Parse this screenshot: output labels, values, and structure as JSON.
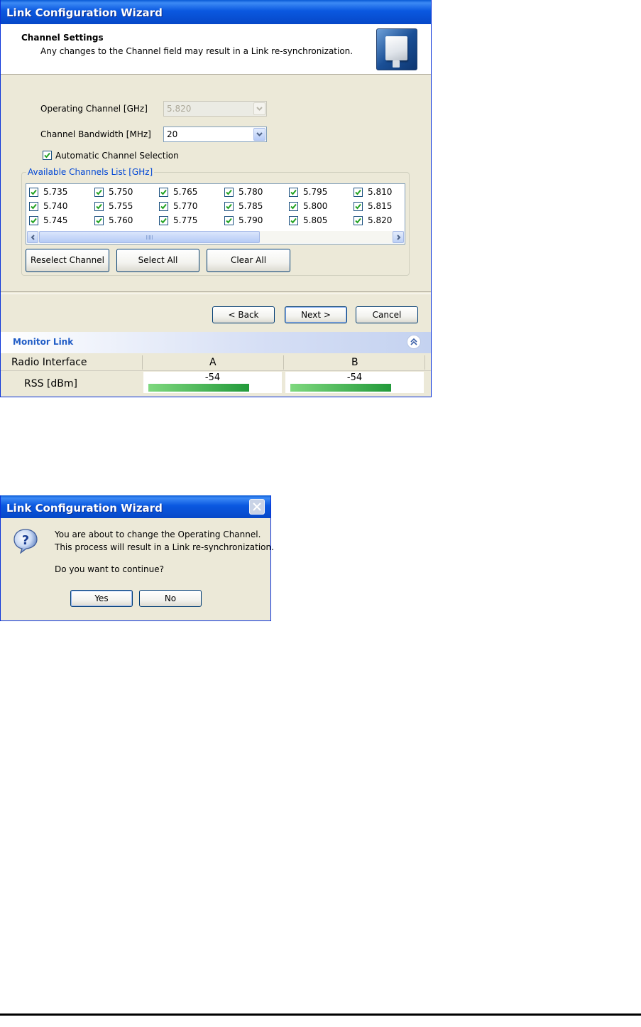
{
  "wizard": {
    "title": "Link Configuration Wizard",
    "header": {
      "title": "Channel Settings",
      "subtitle": "Any changes to the Channel field may result in a Link re-synchronization.",
      "icon": "antenna-panel-icon"
    },
    "operating_channel": {
      "label": "Operating Channel [GHz]",
      "value": "5.820",
      "disabled": true
    },
    "channel_bandwidth": {
      "label": "Channel Bandwidth [MHz]",
      "value": "20"
    },
    "auto_channel": {
      "label": "Automatic Channel Selection",
      "checked": true
    },
    "channels_group": {
      "legend": "Available Channels List [GHz]",
      "channels": [
        [
          "5.735",
          "5.750",
          "5.765",
          "5.780",
          "5.795",
          "5.810"
        ],
        [
          "5.740",
          "5.755",
          "5.770",
          "5.785",
          "5.800",
          "5.815"
        ],
        [
          "5.745",
          "5.760",
          "5.775",
          "5.790",
          "5.805",
          "5.820"
        ]
      ],
      "all_checked": true
    },
    "buttons": {
      "reselect": "Reselect Channel",
      "select_all": "Select All",
      "clear_all": "Clear All",
      "back": "< Back",
      "next": "Next >",
      "cancel": "Cancel"
    }
  },
  "monitor": {
    "title": "Monitor Link",
    "header_label": "Radio Interface",
    "columns": [
      "A",
      "B"
    ],
    "row_label": "RSS [dBm]",
    "values": [
      "-54",
      "-54"
    ]
  },
  "dialog": {
    "title": "Link Configuration Wizard",
    "icon": "question-icon",
    "line1": "You are about to change the Operating Channel.",
    "line2": "This process will result in a Link re-synchronization.",
    "line3": "Do you want to continue?",
    "yes": "Yes",
    "no": "No"
  },
  "colors": {
    "title_bar": "#0a58e0",
    "dialog_face": "#ece9d8",
    "link_blue": "#0046d5",
    "rss_bar": "#229a3a"
  }
}
